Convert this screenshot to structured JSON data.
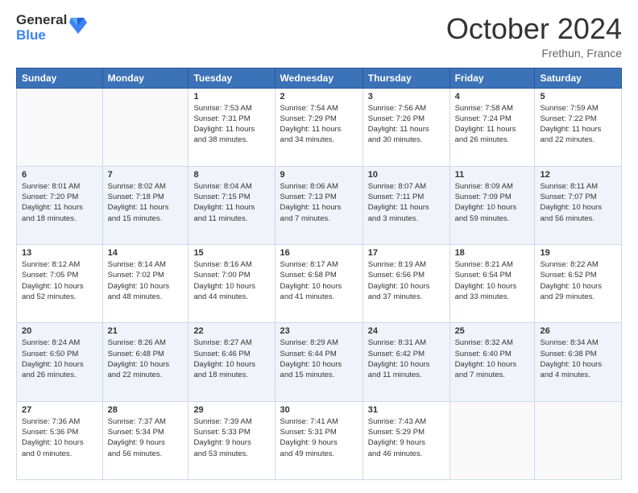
{
  "logo": {
    "line1": "General",
    "line2": "Blue"
  },
  "header": {
    "month": "October 2024",
    "location": "Frethun, France"
  },
  "days_of_week": [
    "Sunday",
    "Monday",
    "Tuesday",
    "Wednesday",
    "Thursday",
    "Friday",
    "Saturday"
  ],
  "weeks": [
    [
      {
        "day": "",
        "info": ""
      },
      {
        "day": "",
        "info": ""
      },
      {
        "day": "1",
        "info": "Sunrise: 7:53 AM\nSunset: 7:31 PM\nDaylight: 11 hours\nand 38 minutes."
      },
      {
        "day": "2",
        "info": "Sunrise: 7:54 AM\nSunset: 7:29 PM\nDaylight: 11 hours\nand 34 minutes."
      },
      {
        "day": "3",
        "info": "Sunrise: 7:56 AM\nSunset: 7:26 PM\nDaylight: 11 hours\nand 30 minutes."
      },
      {
        "day": "4",
        "info": "Sunrise: 7:58 AM\nSunset: 7:24 PM\nDaylight: 11 hours\nand 26 minutes."
      },
      {
        "day": "5",
        "info": "Sunrise: 7:59 AM\nSunset: 7:22 PM\nDaylight: 11 hours\nand 22 minutes."
      }
    ],
    [
      {
        "day": "6",
        "info": "Sunrise: 8:01 AM\nSunset: 7:20 PM\nDaylight: 11 hours\nand 18 minutes."
      },
      {
        "day": "7",
        "info": "Sunrise: 8:02 AM\nSunset: 7:18 PM\nDaylight: 11 hours\nand 15 minutes."
      },
      {
        "day": "8",
        "info": "Sunrise: 8:04 AM\nSunset: 7:15 PM\nDaylight: 11 hours\nand 11 minutes."
      },
      {
        "day": "9",
        "info": "Sunrise: 8:06 AM\nSunset: 7:13 PM\nDaylight: 11 hours\nand 7 minutes."
      },
      {
        "day": "10",
        "info": "Sunrise: 8:07 AM\nSunset: 7:11 PM\nDaylight: 11 hours\nand 3 minutes."
      },
      {
        "day": "11",
        "info": "Sunrise: 8:09 AM\nSunset: 7:09 PM\nDaylight: 10 hours\nand 59 minutes."
      },
      {
        "day": "12",
        "info": "Sunrise: 8:11 AM\nSunset: 7:07 PM\nDaylight: 10 hours\nand 56 minutes."
      }
    ],
    [
      {
        "day": "13",
        "info": "Sunrise: 8:12 AM\nSunset: 7:05 PM\nDaylight: 10 hours\nand 52 minutes."
      },
      {
        "day": "14",
        "info": "Sunrise: 8:14 AM\nSunset: 7:02 PM\nDaylight: 10 hours\nand 48 minutes."
      },
      {
        "day": "15",
        "info": "Sunrise: 8:16 AM\nSunset: 7:00 PM\nDaylight: 10 hours\nand 44 minutes."
      },
      {
        "day": "16",
        "info": "Sunrise: 8:17 AM\nSunset: 6:58 PM\nDaylight: 10 hours\nand 41 minutes."
      },
      {
        "day": "17",
        "info": "Sunrise: 8:19 AM\nSunset: 6:56 PM\nDaylight: 10 hours\nand 37 minutes."
      },
      {
        "day": "18",
        "info": "Sunrise: 8:21 AM\nSunset: 6:54 PM\nDaylight: 10 hours\nand 33 minutes."
      },
      {
        "day": "19",
        "info": "Sunrise: 8:22 AM\nSunset: 6:52 PM\nDaylight: 10 hours\nand 29 minutes."
      }
    ],
    [
      {
        "day": "20",
        "info": "Sunrise: 8:24 AM\nSunset: 6:50 PM\nDaylight: 10 hours\nand 26 minutes."
      },
      {
        "day": "21",
        "info": "Sunrise: 8:26 AM\nSunset: 6:48 PM\nDaylight: 10 hours\nand 22 minutes."
      },
      {
        "day": "22",
        "info": "Sunrise: 8:27 AM\nSunset: 6:46 PM\nDaylight: 10 hours\nand 18 minutes."
      },
      {
        "day": "23",
        "info": "Sunrise: 8:29 AM\nSunset: 6:44 PM\nDaylight: 10 hours\nand 15 minutes."
      },
      {
        "day": "24",
        "info": "Sunrise: 8:31 AM\nSunset: 6:42 PM\nDaylight: 10 hours\nand 11 minutes."
      },
      {
        "day": "25",
        "info": "Sunrise: 8:32 AM\nSunset: 6:40 PM\nDaylight: 10 hours\nand 7 minutes."
      },
      {
        "day": "26",
        "info": "Sunrise: 8:34 AM\nSunset: 6:38 PM\nDaylight: 10 hours\nand 4 minutes."
      }
    ],
    [
      {
        "day": "27",
        "info": "Sunrise: 7:36 AM\nSunset: 5:36 PM\nDaylight: 10 hours\nand 0 minutes."
      },
      {
        "day": "28",
        "info": "Sunrise: 7:37 AM\nSunset: 5:34 PM\nDaylight: 9 hours\nand 56 minutes."
      },
      {
        "day": "29",
        "info": "Sunrise: 7:39 AM\nSunset: 5:33 PM\nDaylight: 9 hours\nand 53 minutes."
      },
      {
        "day": "30",
        "info": "Sunrise: 7:41 AM\nSunset: 5:31 PM\nDaylight: 9 hours\nand 49 minutes."
      },
      {
        "day": "31",
        "info": "Sunrise: 7:43 AM\nSunset: 5:29 PM\nDaylight: 9 hours\nand 46 minutes."
      },
      {
        "day": "",
        "info": ""
      },
      {
        "day": "",
        "info": ""
      }
    ]
  ]
}
